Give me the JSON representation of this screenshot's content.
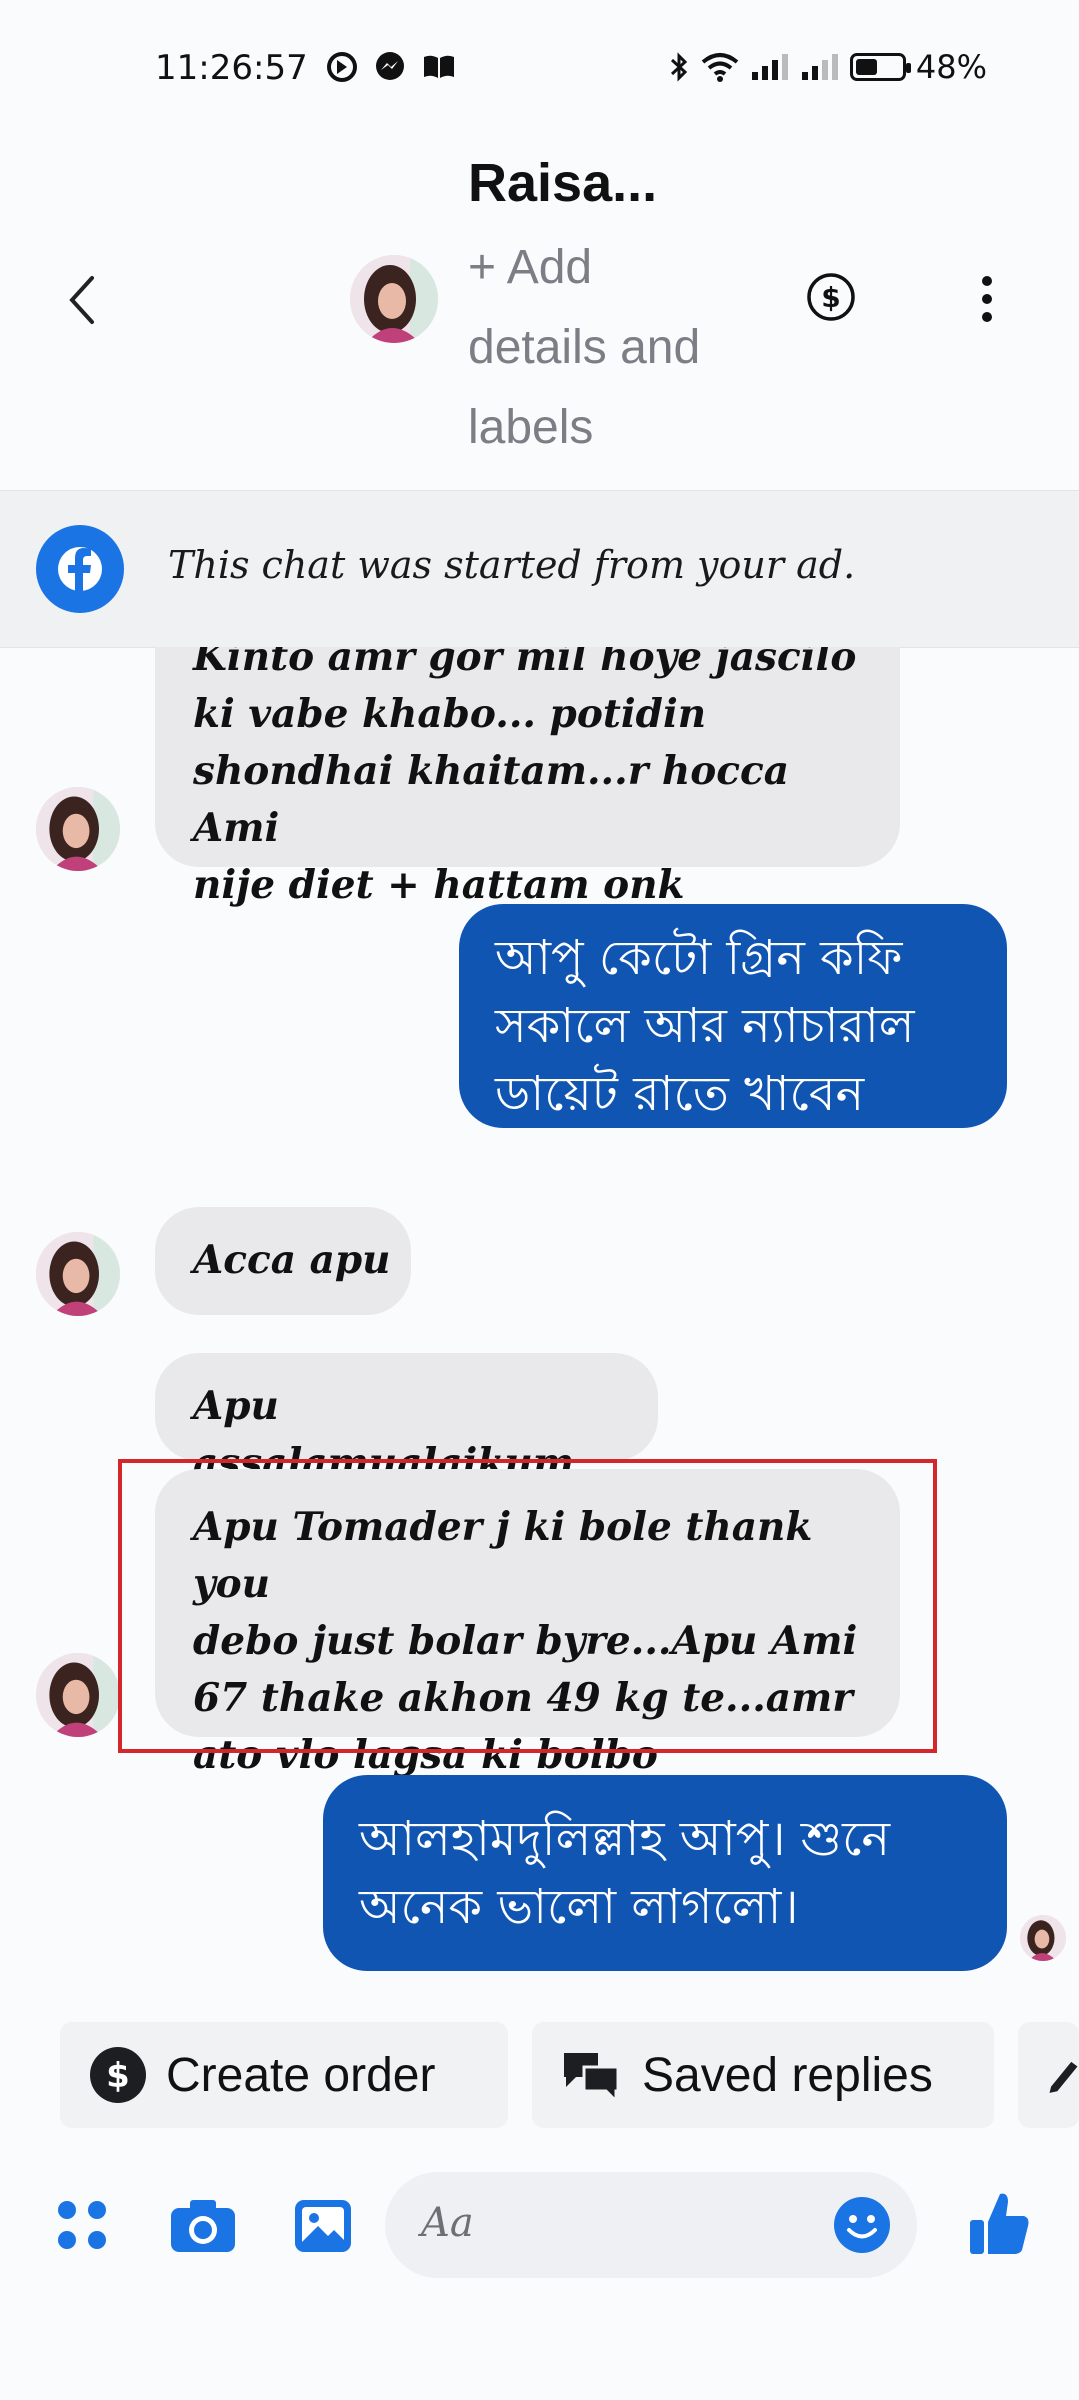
{
  "status_bar": {
    "time": "11:26:57",
    "battery": "48%",
    "battery_level": 0.48
  },
  "header": {
    "contact_name": "Raisa...",
    "add_details": "+ Add details and labels",
    "back_icon": "chevron-left-icon",
    "payment_icon": "dollar-circle-icon",
    "more_icon": "vertical-dots-icon"
  },
  "ad_banner": {
    "text": "This chat was started from your ad.",
    "icon": "facebook-icon",
    "icon_color": "#1b74e4"
  },
  "messages": [
    {
      "sender": "contact",
      "lines": [
        "Kinto amr gor mil hoye jascilo",
        "ki vabe khabo... potidin",
        "shondhai khaitam...r hocca Ami",
        "nije diet + hattam onk"
      ]
    },
    {
      "sender": "me",
      "lines": [
        "আপু কেটো গ্রিন কফি",
        "সকালে আর ন্যাচারাল",
        "ডায়েট রাতে খাবেন"
      ]
    },
    {
      "sender": "contact",
      "lines": [
        "Acca apu"
      ]
    },
    {
      "sender": "contact",
      "lines": [
        "Apu assalamualaikum"
      ]
    },
    {
      "sender": "contact",
      "lines": [
        "Apu Tomader j ki bole thank you",
        "debo just bolar byre...Apu Ami",
        "67 thake akhon 49 kg te...amr",
        "ato vlo lagsa ki bolbo"
      ],
      "highlighted": true
    },
    {
      "sender": "me",
      "lines": [
        "আলহামদুলিল্লাহ আপু। শুনে",
        "অনেক ভালো লাগলো।"
      ],
      "seen": true
    }
  ],
  "actions": {
    "create_order": "Create order",
    "saved_replies": "Saved replies"
  },
  "composer": {
    "placeholder": "Aa",
    "accent": "#1b74e4"
  },
  "colors": {
    "outgoing_bubble": "#1155b3",
    "incoming_bubble": "#e9e9eb",
    "highlight_border": "#d3272b"
  }
}
